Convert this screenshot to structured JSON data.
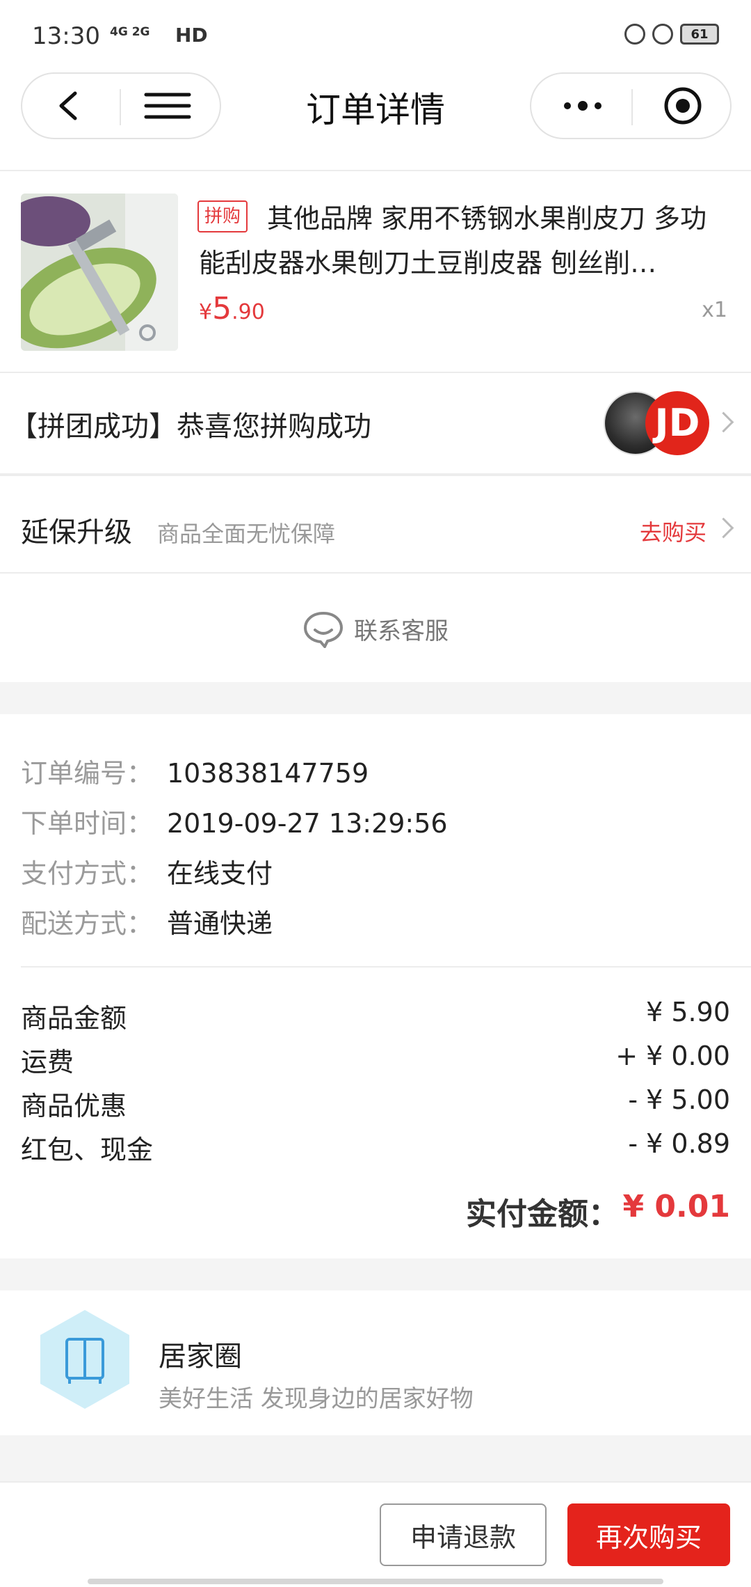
{
  "status_bar": {
    "time": "13:30",
    "network": "4G 2G",
    "hd": "HD",
    "battery": "61"
  },
  "header": {
    "title": "订单详情"
  },
  "product": {
    "tag": "拼购",
    "title": "其他品牌 家用不锈钢水果削皮刀 多功能刮皮器水果刨刀土豆削皮器 刨丝削…",
    "price_symbol": "¥",
    "price_int": "5",
    "price_dec": ".90",
    "quantity": "x1"
  },
  "group": {
    "text": "【拼团成功】恭喜您拼购成功",
    "avatar2_text": "JD"
  },
  "warranty": {
    "title": "延保升级",
    "subtitle": "商品全面无忧保障",
    "action": "去购买"
  },
  "customer_service": {
    "label": "联系客服"
  },
  "order_info": [
    {
      "label": "订单编号：",
      "value": "103838147759"
    },
    {
      "label": "下单时间：",
      "value": "2019-09-27 13:29:56"
    },
    {
      "label": "支付方式：",
      "value": "在线支付"
    },
    {
      "label": "配送方式：",
      "value": "普通快递"
    }
  ],
  "amounts": [
    {
      "label": "商品金额",
      "value": "¥ 5.90"
    },
    {
      "label": "运费",
      "value": "+ ¥ 0.00"
    },
    {
      "label": "商品优惠",
      "value": "- ¥ 5.00"
    },
    {
      "label": "红包、现金",
      "value": "- ¥ 0.89"
    }
  ],
  "paid": {
    "label": "实付金额：",
    "value": "¥ 0.01"
  },
  "home_circle": {
    "title": "居家圈",
    "description": "美好生活 发现身边的居家好物"
  },
  "bottom": {
    "refund": "申请退款",
    "rebuy": "再次购买"
  },
  "colors": {
    "accent_red": "#e4393c",
    "button_red": "#e4231c"
  }
}
